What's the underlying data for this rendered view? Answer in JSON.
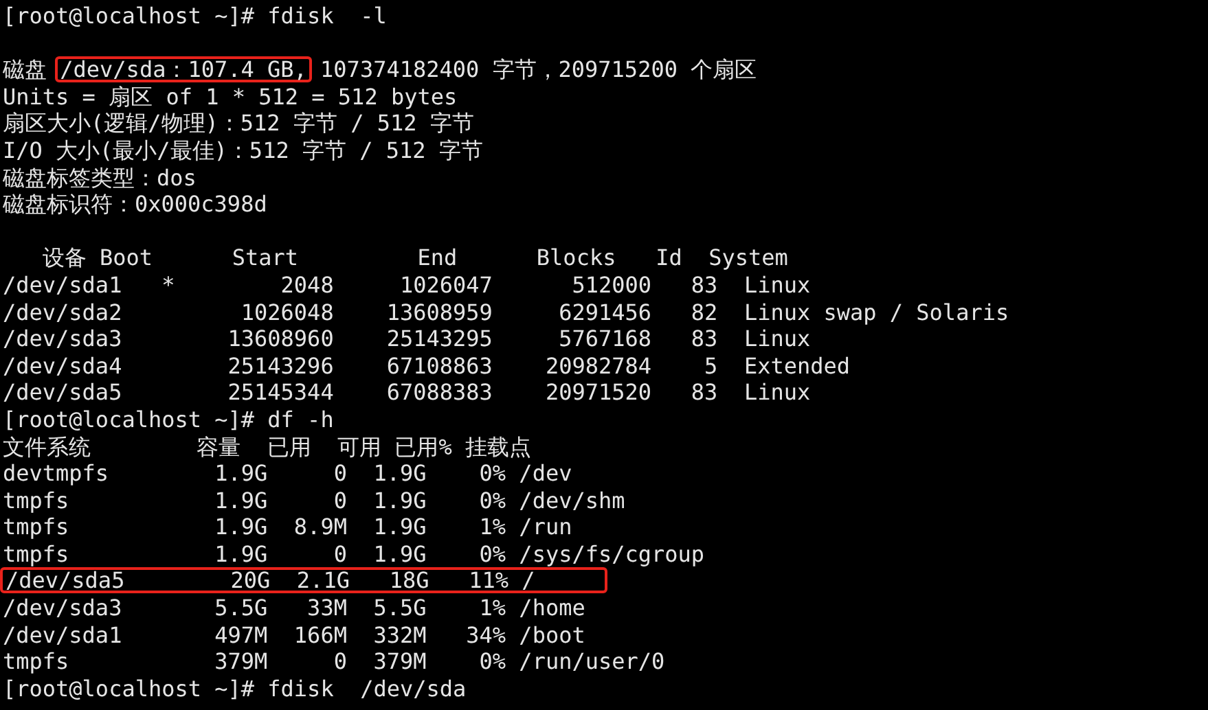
{
  "terminal": {
    "lines": [
      {
        "kind": "text",
        "segments": [
          {
            "text": "[root@localhost ~]# fdisk  -l",
            "boxed": false
          }
        ]
      },
      {
        "kind": "blank"
      },
      {
        "kind": "text",
        "segments": [
          {
            "text": "磁盘 ",
            "boxed": false
          },
          {
            "text": "/dev/sda：107.4 GB,",
            "boxed": true
          },
          {
            "text": " 107374182400 字节，209715200 个扇区",
            "boxed": false
          }
        ]
      },
      {
        "kind": "text",
        "segments": [
          {
            "text": "Units = 扇区 of 1 * 512 = 512 bytes",
            "boxed": false
          }
        ]
      },
      {
        "kind": "text",
        "segments": [
          {
            "text": "扇区大小(逻辑/物理)：512 字节 / 512 字节",
            "boxed": false
          }
        ]
      },
      {
        "kind": "text",
        "segments": [
          {
            "text": "I/O 大小(最小/最佳)：512 字节 / 512 字节",
            "boxed": false
          }
        ]
      },
      {
        "kind": "text",
        "segments": [
          {
            "text": "磁盘标签类型：dos",
            "boxed": false
          }
        ]
      },
      {
        "kind": "text",
        "segments": [
          {
            "text": "磁盘标识符：0x000c398d",
            "boxed": false
          }
        ]
      },
      {
        "kind": "blank"
      },
      {
        "kind": "text",
        "segments": [
          {
            "text": "   设备 Boot      Start         End      Blocks   Id  System",
            "boxed": false
          }
        ]
      },
      {
        "kind": "text",
        "segments": [
          {
            "text": "/dev/sda1   *        2048     1026047      512000   83  Linux",
            "boxed": false
          }
        ]
      },
      {
        "kind": "text",
        "segments": [
          {
            "text": "/dev/sda2         1026048    13608959     6291456   82  Linux swap / Solaris",
            "boxed": false
          }
        ]
      },
      {
        "kind": "text",
        "segments": [
          {
            "text": "/dev/sda3        13608960    25143295     5767168   83  Linux",
            "boxed": false
          }
        ]
      },
      {
        "kind": "text",
        "segments": [
          {
            "text": "/dev/sda4        25143296    67108863    20982784    5  Extended",
            "boxed": false
          }
        ]
      },
      {
        "kind": "text",
        "segments": [
          {
            "text": "/dev/sda5        25145344    67088383    20971520   83  Linux",
            "boxed": false
          }
        ]
      },
      {
        "kind": "text",
        "segments": [
          {
            "text": "[root@localhost ~]# df -h",
            "boxed": false
          }
        ]
      },
      {
        "kind": "text",
        "segments": [
          {
            "text": "文件系统        容量  已用  可用 已用% 挂载点",
            "boxed": false
          }
        ]
      },
      {
        "kind": "text",
        "segments": [
          {
            "text": "devtmpfs        1.9G     0  1.9G    0% /dev",
            "boxed": false
          }
        ]
      },
      {
        "kind": "text",
        "segments": [
          {
            "text": "tmpfs           1.9G     0  1.9G    0% /dev/shm",
            "boxed": false
          }
        ]
      },
      {
        "kind": "text",
        "segments": [
          {
            "text": "tmpfs           1.9G  8.9M  1.9G    1% /run",
            "boxed": false
          }
        ]
      },
      {
        "kind": "text",
        "segments": [
          {
            "text": "tmpfs           1.9G     0  1.9G    0% /sys/fs/cgroup",
            "boxed": false
          }
        ]
      },
      {
        "kind": "text",
        "segments": [
          {
            "text": "/dev/sda5        20G  2.1G   18G   11% /",
            "boxed": true
          }
        ]
      },
      {
        "kind": "text",
        "segments": [
          {
            "text": "/dev/sda3       5.5G   33M  5.5G    1% /home",
            "boxed": false
          }
        ]
      },
      {
        "kind": "text",
        "segments": [
          {
            "text": "/dev/sda1       497M  166M  332M   34% /boot",
            "boxed": false
          }
        ]
      },
      {
        "kind": "text",
        "segments": [
          {
            "text": "tmpfs           379M     0  379M    0% /run/user/0",
            "boxed": false
          }
        ]
      },
      {
        "kind": "text",
        "segments": [
          {
            "text": "[root@localhost ~]# fdisk  /dev/sda",
            "boxed": false
          }
        ]
      }
    ]
  }
}
